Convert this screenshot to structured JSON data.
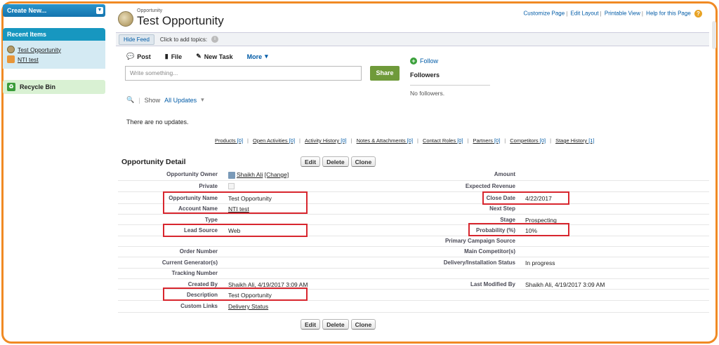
{
  "sidebar": {
    "create_label": "Create New...",
    "recent_title": "Recent Items",
    "recent_items": [
      "Test Opportunity",
      "NTI test"
    ],
    "recycle_label": "Recycle Bin"
  },
  "header": {
    "object_type": "Opportunity",
    "title": "Test Opportunity",
    "links": [
      "Customize Page",
      "Edit Layout",
      "Printable View",
      "Help for this Page"
    ]
  },
  "feed": {
    "hide_feed": "Hide Feed",
    "add_topics": "Click to add topics:",
    "tabs": [
      "Post",
      "File",
      "New Task",
      "More"
    ],
    "placeholder": "Write something...",
    "share": "Share",
    "follow": "Follow",
    "followers_title": "Followers",
    "no_followers": "No followers.",
    "show_label": "Show",
    "show_value": "All Updates",
    "no_updates": "There are no updates."
  },
  "related": [
    {
      "name": "Products",
      "count": "[0]"
    },
    {
      "name": "Open Activities",
      "count": "[0]"
    },
    {
      "name": "Activity History",
      "count": "[0]"
    },
    {
      "name": "Notes & Attachments",
      "count": "[0]"
    },
    {
      "name": "Contact Roles",
      "count": "[0]"
    },
    {
      "name": "Partners",
      "count": "[0]"
    },
    {
      "name": "Competitors",
      "count": "[0]"
    },
    {
      "name": "Stage History",
      "count": "[1]"
    }
  ],
  "detail": {
    "title": "Opportunity Detail",
    "buttons": [
      "Edit",
      "Delete",
      "Clone"
    ],
    "left": {
      "owner_label": "Opportunity Owner",
      "owner_value": "Shaikh Ali",
      "owner_change": "[Change]",
      "private_label": "Private",
      "name_label": "Opportunity Name",
      "name_value": "Test Opportunity",
      "account_label": "Account Name",
      "account_value": "NTI test",
      "type_label": "Type",
      "lead_label": "Lead Source",
      "lead_value": "Web",
      "order_label": "Order Number",
      "gen_label": "Current Generator(s)",
      "track_label": "Tracking Number",
      "created_label": "Created By",
      "created_user": "Shaikh Ali",
      "created_date": ", 4/19/2017 3:09 AM",
      "desc_label": "Description",
      "desc_value": "Test Opportunity",
      "custom_label": "Custom Links",
      "custom_value": "Delivery Status"
    },
    "right": {
      "amount_label": "Amount",
      "exp_label": "Expected Revenue",
      "close_label": "Close Date",
      "close_value": "4/22/2017",
      "next_label": "Next Step",
      "stage_label": "Stage",
      "stage_value": "Prospecting",
      "prob_label": "Probability (%)",
      "prob_value": "10%",
      "campaign_label": "Primary Campaign Source",
      "comp_label": "Main Competitor(s)",
      "deliv_label": "Delivery/Installation Status",
      "deliv_value": "In progress",
      "mod_label": "Last Modified By",
      "mod_user": "Shaikh Ali",
      "mod_date": ", 4/19/2017 3:09 AM"
    }
  }
}
